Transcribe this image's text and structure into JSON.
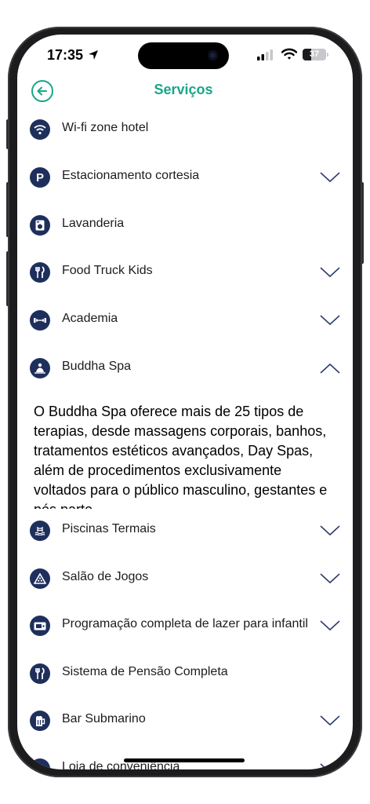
{
  "status_bar": {
    "time": "17:35",
    "battery": "37"
  },
  "header": {
    "title": "Serviços"
  },
  "services": [
    {
      "label": "Wi-fi zone hotel",
      "icon": "wifi-icon",
      "expandable": false
    },
    {
      "label": "Estacionamento cortesia",
      "icon": "parking-icon",
      "expandable": true
    },
    {
      "label": "Lavanderia",
      "icon": "laundry-icon",
      "expandable": false
    },
    {
      "label": "Food Truck Kids",
      "icon": "cutlery-icon",
      "expandable": true
    },
    {
      "label": "Academia",
      "icon": "dumbbell-icon",
      "expandable": true
    },
    {
      "label": "Buddha Spa",
      "icon": "spa-icon",
      "expandable": true,
      "expanded": true
    },
    {
      "label": "Piscinas Termais",
      "icon": "pool-icon",
      "expandable": true
    },
    {
      "label": "Salão de Jogos",
      "icon": "games-icon",
      "expandable": true
    },
    {
      "label": "Programação completa de lazer para infantil",
      "icon": "ticket-icon",
      "expandable": true
    },
    {
      "label": "Sistema de Pensão Completa",
      "icon": "cutlery-icon",
      "expandable": false
    },
    {
      "label": "Bar Submarino",
      "icon": "beer-icon",
      "expandable": true
    },
    {
      "label": "Loja de conveniência",
      "icon": "store-icon",
      "expandable": true
    }
  ],
  "spa_description": "O Buddha Spa oferece mais de 25 tipos de terapias, desde massagens corporais, banhos, tratamentos estéticos avançados, Day Spas, além de procedimentos exclusivamente voltados para o público masculino, gestantes e pós parto",
  "colors": {
    "accent": "#1aa68a",
    "icon_bg": "#1f2f5c",
    "chevron": "#2c3e70"
  }
}
